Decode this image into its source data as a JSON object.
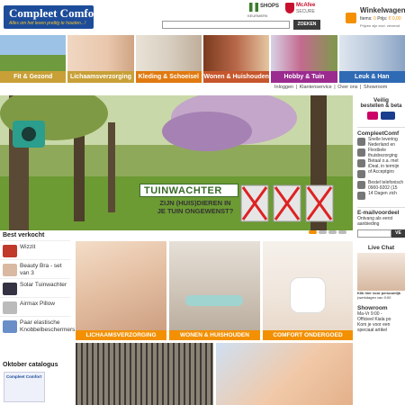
{
  "header": {
    "logo_title": "Compleet Comfort",
    "logo_tagline": "Alles om het leven prettig te houden...!",
    "shops_badge": "SHOPS",
    "shops_sub": "KEURMERK",
    "mcafee": "McAfee",
    "mcafee_sub": "SECURE",
    "search_placeholder": "",
    "search_button": "ZOEKEN",
    "cart_title": "Winkelwagen",
    "cart_items_label": "Items:",
    "cart_items_value": "0",
    "cart_price_label": "Prijs:",
    "cart_price_value": "€ 0,00",
    "cart_note": "Prijzen zijn excl. verzend"
  },
  "categories": [
    {
      "label": "Fit & Gezond",
      "color": "#c8a037"
    },
    {
      "label": "Lichaamsverzorging",
      "color": "#c8a037"
    },
    {
      "label": "Kleding & Schoeisel",
      "color": "#e07a10"
    },
    {
      "label": "Wonen & Huishouden",
      "color": "#c6562b"
    },
    {
      "label": "Hobby & Tuin",
      "color": "#9b2b8f"
    },
    {
      "label": "Leuk & Han",
      "color": "#2f6ab5"
    }
  ],
  "util_links": [
    "Inloggen",
    "Klantenservice",
    "Over ons",
    "Showroom"
  ],
  "hero": {
    "title": "TUINWACHTER",
    "subtitle_line1": "ZIJN (HUIS)DIEREN IN",
    "subtitle_line2": "JE TUIN ONGEWENST?"
  },
  "right_sidebar": {
    "secure_title": "Veilig",
    "secure_sub": "bestellen & beta",
    "brand_title": "CompleetComf",
    "features": [
      {
        "line1": "Snelle levering",
        "line2": "Nederland en"
      },
      {
        "line1": "Flexibele",
        "line2": "thuisbezorging"
      },
      {
        "line1": "Betaal o.a. met",
        "line2": "iDeal, in termijn"
      },
      {
        "line1": "of Acceptgiro",
        "line2": ""
      },
      {
        "line1": "Bestel telefonisch",
        "line2": "0900-9202 (15"
      },
      {
        "line1": "14 Dagen zich",
        "line2": ""
      }
    ],
    "email_title": "E-mailvoordeel",
    "email_sub1": "Ontvang als eerst",
    "email_sub2": "aanbieding",
    "email_button": "VE",
    "chat_title": "Live Chat",
    "chat_caption1": "Klik hier voor persoonlijk",
    "chat_caption2": "(werkdagen van 9:00",
    "showroom_title": "Showroom",
    "showroom_lines": [
      "Ma-Vr   9:00 -",
      "Officieel Kiala po",
      "Kom je voor een",
      "speciaal artikel"
    ]
  },
  "best_sellers": {
    "title": "Best verkocht",
    "items": [
      {
        "label": "Wizzit",
        "color": "#c0392b"
      },
      {
        "label": "Beauty Bra - set van 3",
        "color": "#d9b9a1"
      },
      {
        "label": "Solar Tuinwachter",
        "color": "#334"
      },
      {
        "label": "Airmax Pillow",
        "color": "#bbb"
      },
      {
        "label": "Paar elastische Knobbelbeschermers",
        "color": "#6a8fc8"
      }
    ]
  },
  "promos": [
    {
      "label": "LICHAAMSVERZORGING"
    },
    {
      "label": "WONEN & HUISHOUDEN"
    },
    {
      "label": "COMFORT ONDERGOED"
    }
  ],
  "catalog": {
    "title": "Oktober catalogus",
    "cover_title": "Compleet Comfort"
  }
}
